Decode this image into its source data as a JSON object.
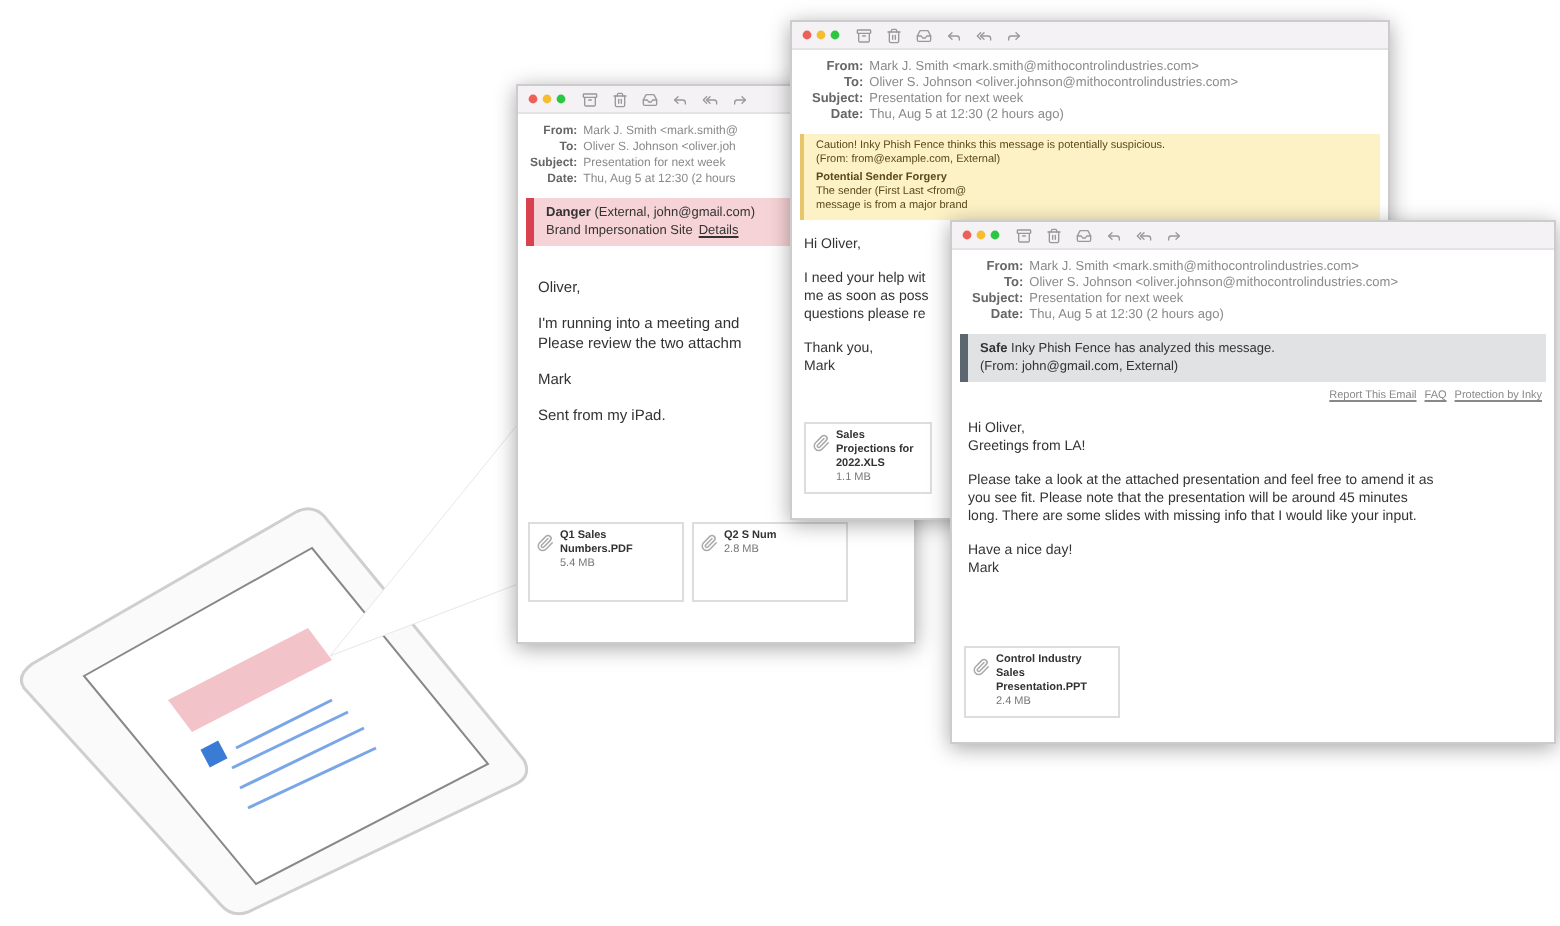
{
  "windows": [
    {
      "kind": "danger",
      "header": [
        {
          "label": "From:",
          "value": "Mark J. Smith <mark.smith@"
        },
        {
          "label": "To:",
          "value": "Oliver S. Johnson <oliver.joh"
        },
        {
          "label": "Subject:",
          "value": "Presentation for next week"
        },
        {
          "label": "Date:",
          "value": "Thu, Aug 5 at 12:30 (2 hours"
        }
      ],
      "banner": {
        "lines": [
          {
            "text": "**Danger** (External, john@gmail.com)"
          },
          {
            "text": "Brand Impersonation Site",
            "link": "Details"
          }
        ]
      },
      "body": [
        [
          "Oliver,"
        ],
        [
          "I'm running into a meeting and",
          "Please review the two attachm"
        ],
        [
          "Mark"
        ],
        [
          "Sent from my iPad."
        ]
      ],
      "attachments": [
        {
          "name": "Q1 Sales Numbers.PDF",
          "size": "5.4 MB"
        },
        {
          "name": "Q2 S Num",
          "size": "2.8 MB"
        }
      ]
    },
    {
      "kind": "caution",
      "header": [
        {
          "label": "From:",
          "value": "Mark J. Smith <mark.smith@mithocontrolindustries.com>"
        },
        {
          "label": "To:",
          "value": "Oliver S. Johnson <oliver.johnson@mithocontrolindustries.com>"
        },
        {
          "label": "Subject:",
          "value": "Presentation for next week"
        },
        {
          "label": "Date:",
          "value": "Thu, Aug 5 at 12:30 (2 hours ago)"
        }
      ],
      "banner": {
        "lines": [
          {
            "text": "Caution! Inky Phish Fence thinks this message is potentially suspicious."
          },
          {
            "text": "(From: from@example.com, External)"
          },
          {
            "text": "**Potential Sender Forgery**"
          },
          {
            "text": "The sender (First Last <from@"
          },
          {
            "text": "message is from a major brand"
          }
        ]
      },
      "body": [
        [
          "Hi Oliver,"
        ],
        [
          "I need your help wit",
          "me as soon as poss",
          "questions please re"
        ],
        [
          "Thank you,",
          "Mark"
        ]
      ],
      "attachments": [
        {
          "name": "Sales Projections for 2022.XLS",
          "size": "1.1 MB"
        }
      ]
    },
    {
      "kind": "safe",
      "header": [
        {
          "label": "From:",
          "value": "Mark J. Smith <mark.smith@mithocontrolindustries.com>"
        },
        {
          "label": "To:",
          "value": "Oliver S. Johnson <oliver.johnson@mithocontrolindustries.com>"
        },
        {
          "label": "Subject:",
          "value": "Presentation for next week"
        },
        {
          "label": "Date:",
          "value": "Thu, Aug 5 at 12:30 (2 hours ago)"
        }
      ],
      "banner": {
        "lines": [
          {
            "text": "**Safe** Inky Phish Fence has analyzed this message."
          },
          {
            "text": "(From: john@gmail.com, External)"
          }
        ]
      },
      "links": [
        "Report This Email",
        "FAQ",
        "Protection by Inky"
      ],
      "body": [
        [
          "Hi Oliver,",
          "Greetings from LA!"
        ],
        [
          "Please take a look at the attached presentation and feel free to amend it as",
          "you see fit. Please note that the presentation will be around 45 minutes",
          "long. There are some slides with missing info that I would like your input."
        ],
        [
          "Have a nice day!",
          "Mark"
        ]
      ],
      "attachments": [
        {
          "name": "Control Industry Sales Presentation.PPT",
          "size": "2.4 MB"
        }
      ]
    }
  ]
}
